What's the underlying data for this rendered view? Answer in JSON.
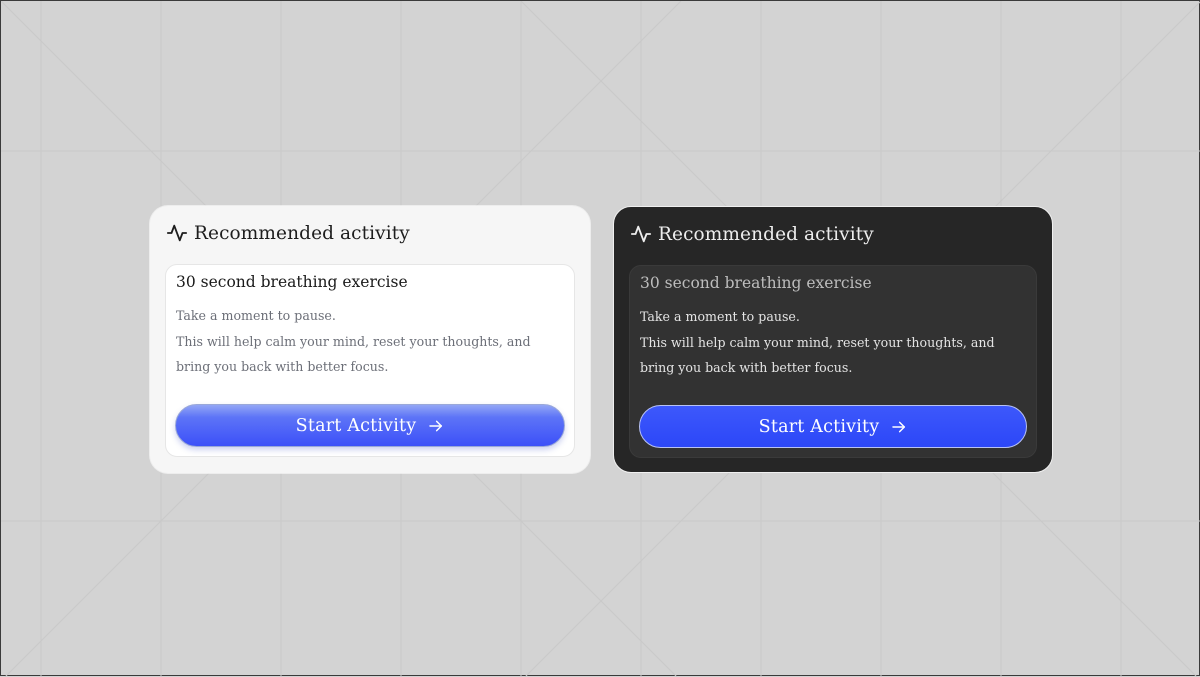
{
  "cards": [
    {
      "theme": "light",
      "header_icon": "activity-pulse-icon",
      "title": "Recommended activity",
      "activity_title": "30 second breathing exercise",
      "line1": "Take a moment to pause.",
      "line2": "This will help calm your mind, reset your thoughts, and bring you back with better focus.",
      "button_label": "Start Activity",
      "button_icon": "arrow-right-icon"
    },
    {
      "theme": "dark",
      "header_icon": "activity-pulse-icon",
      "title": "Recommended activity",
      "activity_title": "30 second breathing exercise",
      "line1": "Take a moment to pause.",
      "line2": "This will help calm your mind, reset your thoughts, and bring you back with better focus.",
      "button_label": "Start Activity",
      "button_icon": "arrow-right-icon"
    }
  ],
  "colors": {
    "background": "#d3d3d3",
    "accent_blue": "#3c50f8",
    "light_card": "#f6f6f6",
    "dark_card": "#262626"
  }
}
